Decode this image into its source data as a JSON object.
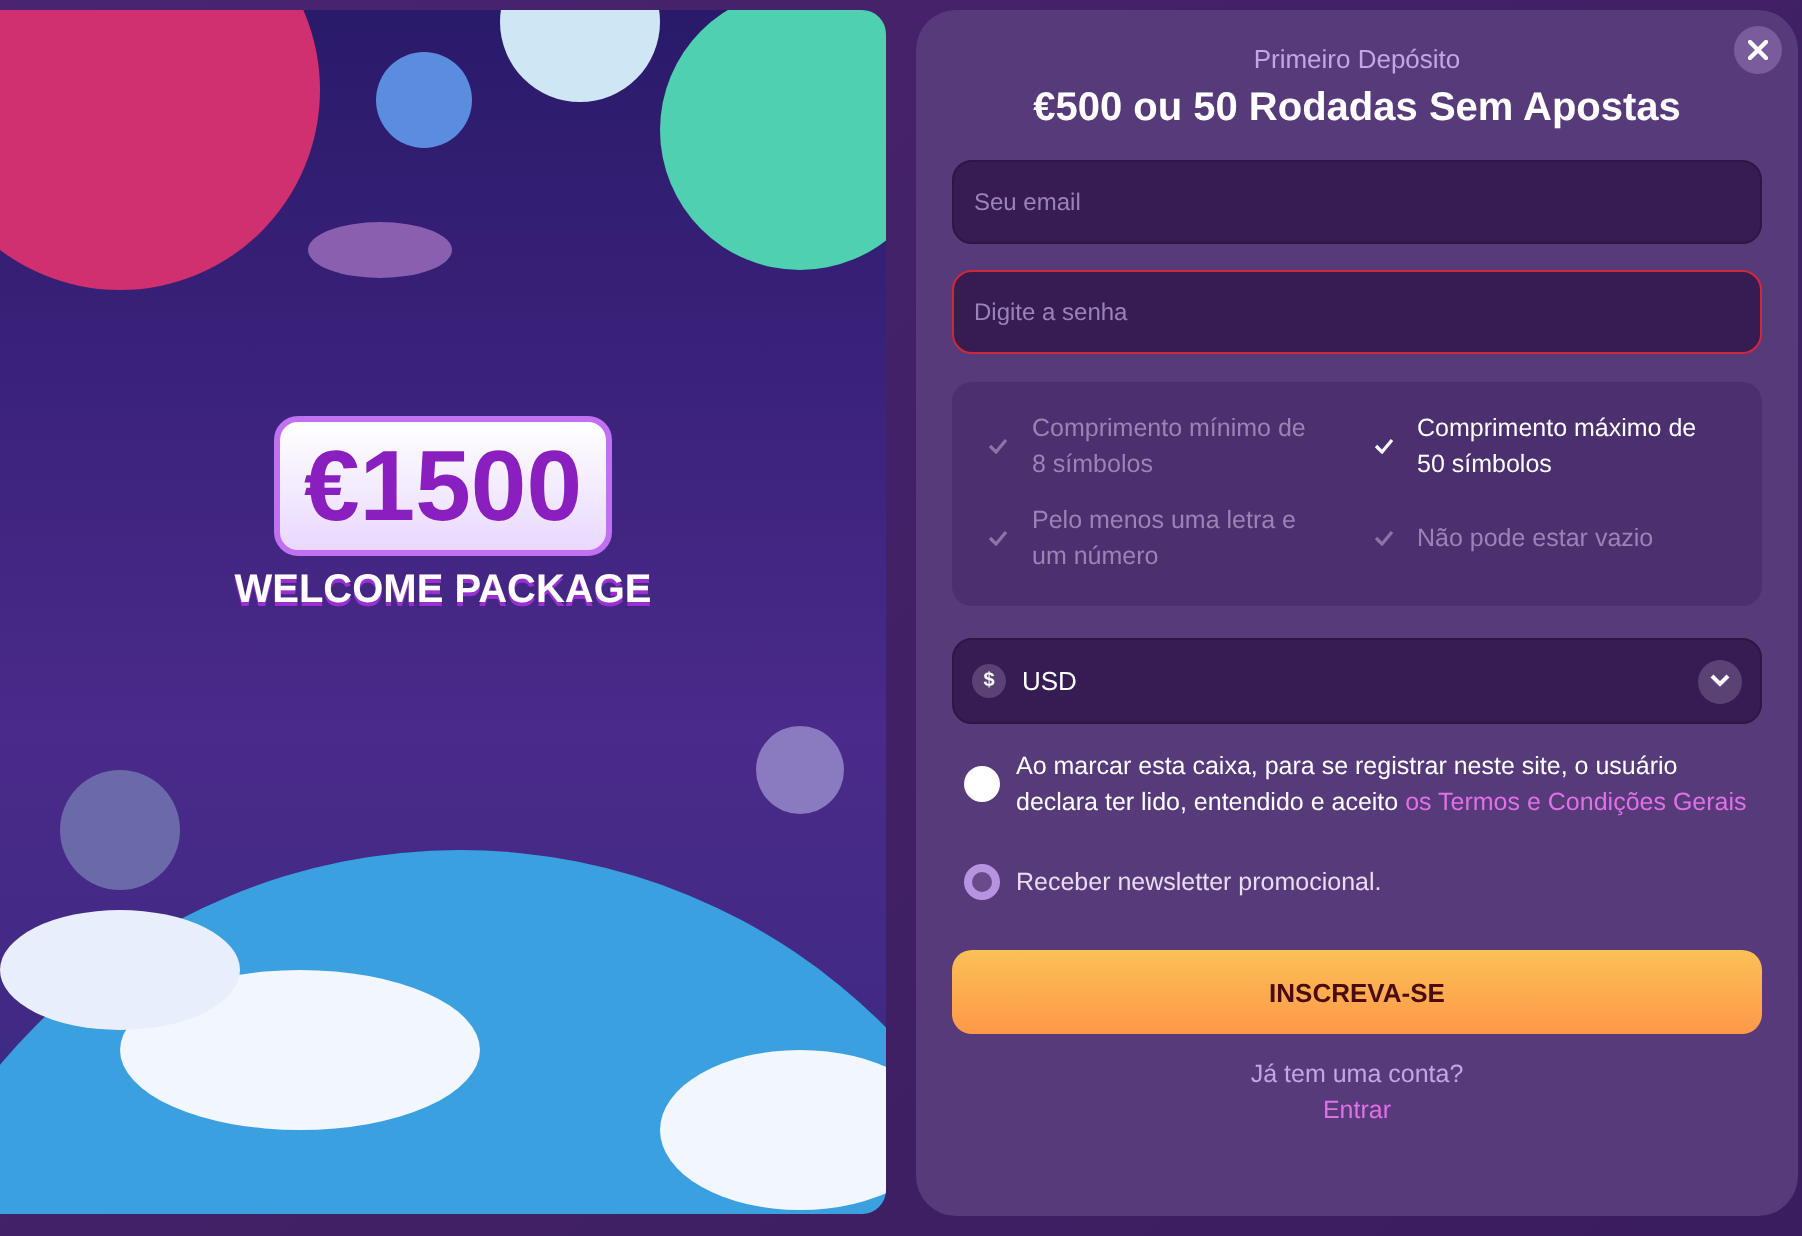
{
  "banner": {
    "amount": "€1500",
    "caption": "WELCOME PACKAGE"
  },
  "form": {
    "subtitle": "Primeiro Depósito",
    "title": "€500 ou 50 Rodadas Sem Apostas",
    "fields": [
      {
        "placeholder": "Seu email",
        "error": false
      },
      {
        "placeholder": "Digite a senha",
        "error": true
      }
    ],
    "requirements": [
      {
        "text": "Comprimento mínimo de 8 símbolos",
        "met": false
      },
      {
        "text": "Comprimento máximo de 50 símbolos",
        "met": true
      },
      {
        "text": "Pelo menos uma letra e um número",
        "met": false
      },
      {
        "text": "Não pode estar vazio",
        "met": false
      }
    ],
    "currency": {
      "symbol": "$",
      "value": "USD"
    },
    "terms": {
      "text": "Ao marcar esta caixa, para se registrar neste site, o usuário declara ter lido, entendido e aceito ",
      "link": "os Termos e Condições Gerais",
      "checked": false
    },
    "newsletter": {
      "label": "Receber newsletter promocional.",
      "checked": true
    },
    "submit": "INSCREVA-SE",
    "login_prompt": "Já tem uma conta?",
    "login_link": "Entrar"
  }
}
